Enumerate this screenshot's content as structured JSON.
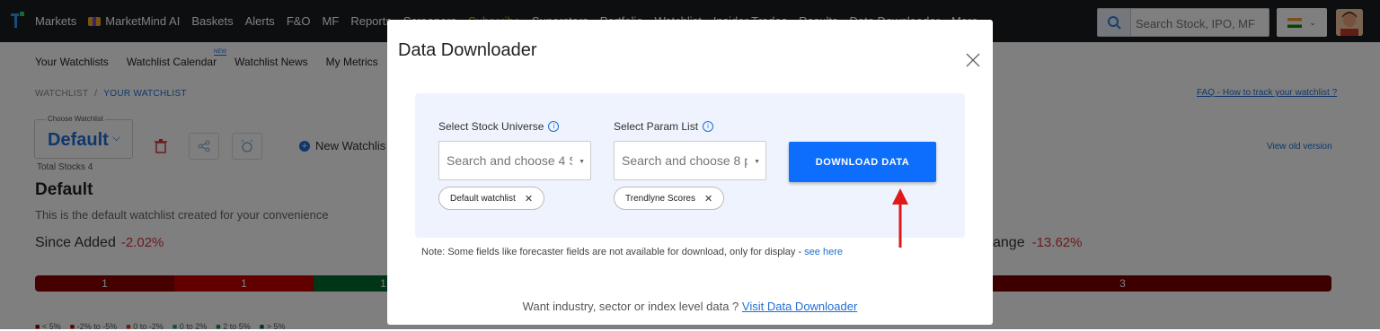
{
  "topnav": {
    "items": [
      "Markets",
      "MarketMind AI",
      "Baskets",
      "Alerts",
      "F&O",
      "MF",
      "Reports",
      "Screeners",
      "Subscribe",
      "Superstars",
      "Portfolio",
      "Watchlist",
      "Insider Trades",
      "Results",
      "Data Downloader",
      "More"
    ],
    "search_placeholder": "Search Stock, IPO, MF"
  },
  "subnav": {
    "items": [
      "Your Watchlists",
      "Watchlist Calendar",
      "Watchlist News",
      "My Metrics"
    ],
    "new_badge": "NEW"
  },
  "breadcrumb": {
    "root": "WATCHLIST",
    "sep": "/",
    "current": "YOUR WATCHLIST"
  },
  "faq_link": "FAQ - How to track your watchlist ?",
  "view_old": "View old version",
  "watchlist": {
    "choose_label": "Choose Watchlist",
    "selected": "Default",
    "new_label": "New Watchlis",
    "total_stocks": "Total Stocks 4",
    "title": "Default",
    "description": "This is the default watchlist created for your convenience",
    "since_added_label": "Since Added",
    "since_added_value": "-2.02%",
    "change_label": "ange",
    "change_value": "-13.62%"
  },
  "distribution": {
    "segments": [
      {
        "label": "1",
        "color": "#8b0000"
      },
      {
        "label": "1",
        "color": "#c40000"
      },
      {
        "label": "1",
        "color": "#006b2e"
      },
      {
        "label": "3",
        "color": "#7a0000"
      }
    ],
    "legend": [
      "< 5%",
      "-2% to -5%",
      "0 to -2%",
      "0 to 2%",
      "2 to 5%",
      "> 5%"
    ]
  },
  "modal": {
    "title": "Data Downloader",
    "universe_label": "Select Stock Universe",
    "universe_placeholder": "Search and choose 4 St...",
    "universe_chip": "Default watchlist",
    "param_label": "Select Param List",
    "param_placeholder": "Search and choose 8 pa...",
    "param_chip": "Trendlyne Scores",
    "download_label": "DOWNLOAD DATA",
    "note_text": "Note: Some fields like forecaster fields are not available for download, only for display -",
    "note_link": "see here",
    "want_text": "Want industry, sector or index level data ?",
    "want_link": "Visit Data Downloader"
  },
  "colors": {
    "accent": "#0d6efd",
    "negative": "#d9343b",
    "arrow": "#e01818"
  }
}
